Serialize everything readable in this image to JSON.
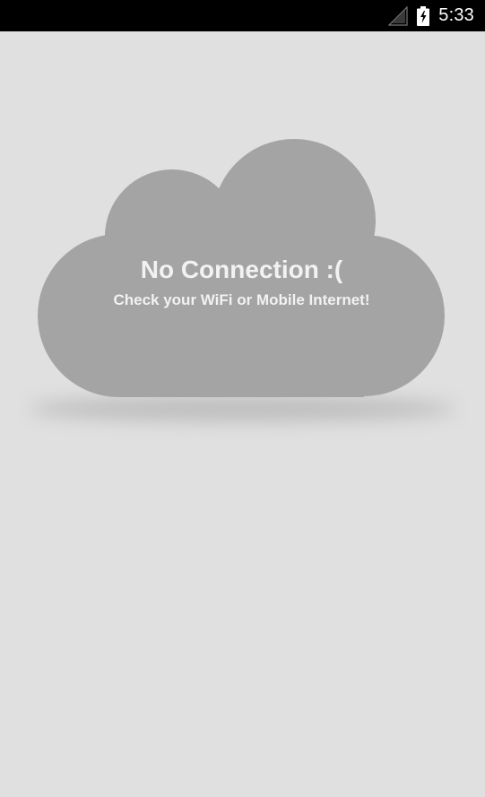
{
  "status_bar": {
    "time": "5:33",
    "icons": [
      "signal-icon",
      "battery-charging-icon"
    ]
  },
  "empty_state": {
    "title": "No Connection :(",
    "message": "Check your WiFi or Mobile Internet!",
    "illustration": "cloud-icon"
  },
  "colors": {
    "status_bar": "#000000",
    "background": "#e0e0e0",
    "cloud": "#a4a4a4",
    "text": "#f2f2f2"
  }
}
